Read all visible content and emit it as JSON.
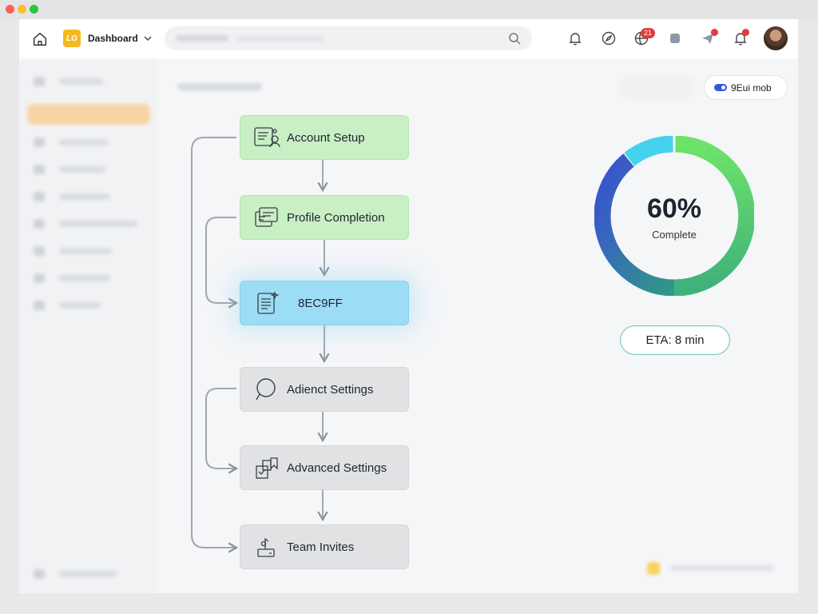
{
  "topbar": {
    "brand_badge": "LG",
    "brand_name": "Dashboard",
    "notification_badge": "21",
    "icons": [
      "home-icon",
      "chevron-down-icon",
      "search-icon",
      "bell-icon",
      "compass-icon",
      "globe-icon",
      "grid-icon",
      "send-icon",
      "bell-icon",
      "avatar"
    ]
  },
  "header": {
    "toggle_label": "9Eui mob"
  },
  "flow": {
    "steps": [
      {
        "label": "Account Setup",
        "status": "done",
        "icon": "account-setup-icon"
      },
      {
        "label": "Profile Completion",
        "status": "done",
        "icon": "profile-icon"
      },
      {
        "label": "8EC9FF",
        "status": "current",
        "icon": "document-icon"
      },
      {
        "label": "Adienct Settings",
        "status": "todo",
        "icon": "search-icon"
      },
      {
        "label": "Advanced Settings",
        "status": "todo",
        "icon": "checklist-icon"
      },
      {
        "label": "Team Invites",
        "status": "todo",
        "icon": "invite-icon"
      }
    ]
  },
  "progress": {
    "percent_label": "60%",
    "percent_value": 60,
    "sub_label": "Complete",
    "eta_label": "ETA: 8 min"
  },
  "colors": {
    "done": "#c9efc4",
    "current": "#9ddcf5",
    "todo": "#e1e2e4",
    "ring_green": "#6ddc6b",
    "ring_blue": "#3d57d6",
    "ring_cyan": "#44d2ee",
    "accent_blue": "#2d5bd9",
    "badge_red": "#e5393b"
  }
}
